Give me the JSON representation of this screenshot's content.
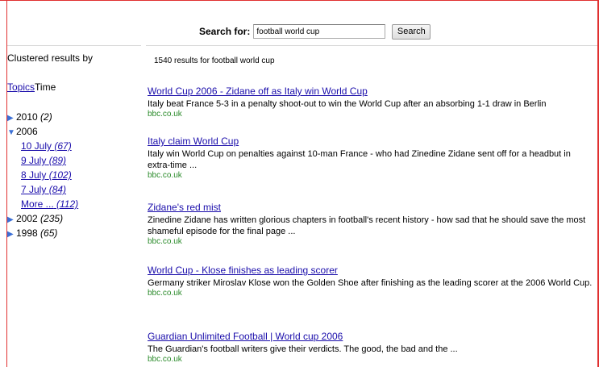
{
  "search": {
    "label": "Search for:",
    "value": "football world cup",
    "button": "Search"
  },
  "sidebar": {
    "title": "Clustered results by",
    "view_topics": "Topics",
    "view_time": "Time",
    "years": [
      {
        "label": "2010",
        "count": "(2)",
        "state": "collapsed"
      },
      {
        "label": "2006",
        "count": "",
        "state": "expanded",
        "children": [
          {
            "label": "10 July",
            "count": "(67)"
          },
          {
            "label": "9 July",
            "count": "(89)"
          },
          {
            "label": "8 July",
            "count": "(102)"
          },
          {
            "label": "7 July",
            "count": "(84)"
          },
          {
            "label": "More ...",
            "count": "(112)"
          }
        ]
      },
      {
        "label": "2002",
        "count": "(235)",
        "state": "collapsed"
      },
      {
        "label": "1998",
        "count": "(65)",
        "state": "collapsed"
      }
    ],
    "icons": {
      "collapsed": "triangle-right-icon",
      "expanded": "triangle-down-icon"
    },
    "icon_color": "#3b6fd6"
  },
  "results": {
    "count_text": "1540 results for football world cup",
    "items": [
      {
        "title": "World Cup 2006 - Zidane off as Italy win World Cup",
        "snippet": "Italy beat France 5-3 in a penalty shoot-out to win the World Cup after an absorbing 1-1 draw in Berlin",
        "url": "bbc.co.uk"
      },
      {
        "title": "Italy claim World Cup",
        "snippet": "Italy win World Cup on penalties against 10-man France - who had Zinedine Zidane sent off for a headbut in extra-time ...",
        "url": "bbc.co.uk"
      },
      {
        "title": "Zidane's red mist",
        "snippet": "Zinedine Zidane has written glorious chapters in football's recent history - how sad that he should save the most shameful episode for the final page ...",
        "url": "bbc.co.uk"
      },
      {
        "title": "World Cup - Klose finishes as leading scorer",
        "snippet": "Germany striker Miroslav Klose won the Golden Shoe after finishing as the leading scorer at the 2006 World Cup.",
        "url": "bbc.co.uk"
      },
      {
        "title": "Guardian Unlimited Football | World cup 2006",
        "snippet": "The Guardian's football writers give their verdicts. The good, the bad and the ...",
        "url": "bbc.co.uk"
      }
    ]
  },
  "colors": {
    "frame": "#e03030",
    "link": "#1a0dab",
    "url": "#2a8a2a"
  }
}
